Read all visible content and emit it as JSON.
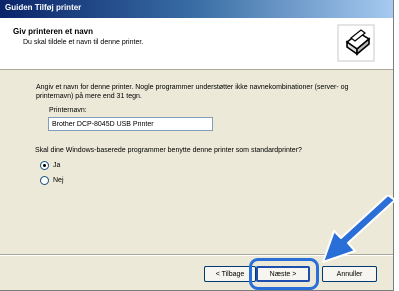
{
  "window": {
    "title": "Guiden Tilføj printer"
  },
  "header": {
    "title": "Giv printeren et navn",
    "subtitle": "Du skal tildele et navn til denne printer.",
    "icon": "printer-wizard-icon"
  },
  "content": {
    "description": "Angiv et navn for denne printer. Nogle programmer understøtter ikke navnekombinationer (server- og printernavn) på mere end 31 tegn.",
    "printer_name_label": "Printernavn:",
    "printer_name_value": "Brother DCP-8045D USB Printer",
    "default_question": "Skal dine Windows-baserede programmer benytte denne printer som standardprinter?",
    "options": [
      {
        "label": "Ja",
        "selected": true
      },
      {
        "label": "Nej",
        "selected": false
      }
    ]
  },
  "buttons": {
    "back": "< Tilbage",
    "next": "Næste >",
    "cancel": "Annuller"
  },
  "colors": {
    "accent": "#2a6fd8",
    "titlebar": "#0a246a"
  }
}
